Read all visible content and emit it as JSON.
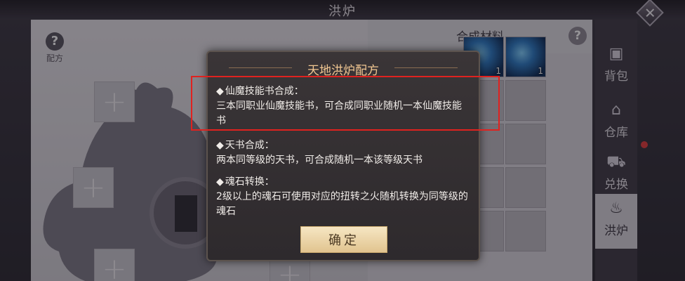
{
  "window": {
    "title": "洪炉"
  },
  "left_panel": {
    "recipe_label": "配方"
  },
  "materials": {
    "header": "合成材料",
    "items": [
      {
        "count": "1",
        "icon": "skill-book-icon"
      },
      {
        "count": "1",
        "icon": "skill-book-icon"
      }
    ]
  },
  "side_tabs": [
    {
      "label": "背包",
      "icon": "bag-icon"
    },
    {
      "label": "仓库",
      "icon": "warehouse-icon"
    },
    {
      "label": "兑换",
      "icon": "exchange-cart-icon"
    },
    {
      "label": "洪炉",
      "icon": "furnace-icon",
      "active": true
    }
  ],
  "dialog": {
    "title": "天地洪炉配方",
    "sections": [
      {
        "heading": "仙魔技能书合成：",
        "text": "三本同职业仙魔技能书，可合成同职业随机一本仙魔技能书"
      },
      {
        "heading": "天书合成：",
        "text": "两本同等级的天书，可合成随机一本该等级天书"
      },
      {
        "heading": "魂石转换：",
        "text": "2级以上的魂石可使用对应的扭转之火随机转换为同等级的魂石"
      }
    ],
    "confirm_label": "确定"
  },
  "colors": {
    "highlight": "#e0221f",
    "dialog_title": "#f2c792",
    "notification_dot": "#e23a3a"
  }
}
